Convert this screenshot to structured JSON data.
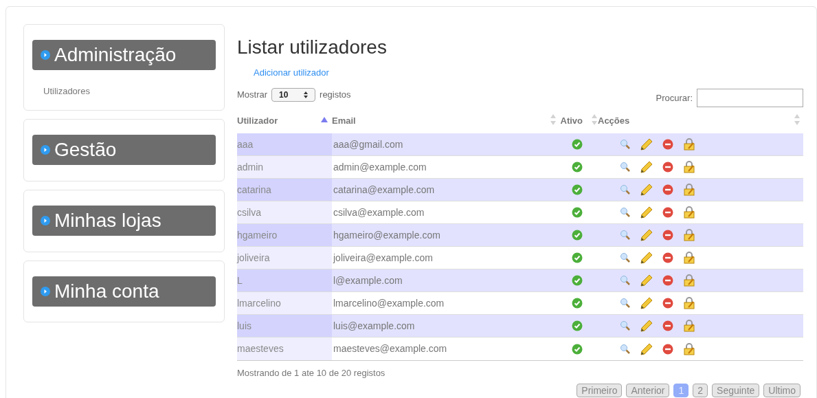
{
  "sidebar": [
    {
      "title": "Administração",
      "items": [
        "Utilizadores"
      ]
    },
    {
      "title": "Gestão"
    },
    {
      "title": "Minhas lojas"
    },
    {
      "title": "Minha conta"
    }
  ],
  "page_title": "Listar utilizadores",
  "add_link": "Adicionar utilizador",
  "length": {
    "before": "Mostrar",
    "value": "10",
    "after": "registos"
  },
  "search": {
    "label": "Procurar:"
  },
  "columns": [
    {
      "label": "Utilizador",
      "sorted": true
    },
    {
      "label": "Email",
      "sorted": false
    },
    {
      "label": "Ativo",
      "sorted": false
    },
    {
      "label": "Acções",
      "sorted": false
    }
  ],
  "rows": [
    {
      "user": "aaa",
      "email": "aaa@gmail.com",
      "active": true
    },
    {
      "user": "admin",
      "email": "admin@example.com",
      "active": true
    },
    {
      "user": "catarina",
      "email": "catarina@example.com",
      "active": true
    },
    {
      "user": "csilva",
      "email": "csilva@example.com",
      "active": true
    },
    {
      "user": "hgameiro",
      "email": "hgameiro@example.com",
      "active": true
    },
    {
      "user": "joliveira",
      "email": "joliveira@example.com",
      "active": true
    },
    {
      "user": "L",
      "email": "l@example.com",
      "active": true
    },
    {
      "user": "lmarcelino",
      "email": "lmarcelino@example.com",
      "active": true
    },
    {
      "user": "luis",
      "email": "luis@example.com",
      "active": true
    },
    {
      "user": "maesteves",
      "email": "maesteves@example.com",
      "active": true
    }
  ],
  "info": "Mostrando de 1 ate 10 de 20 registos",
  "pagination": [
    {
      "label": "Primeiro",
      "selected": false
    },
    {
      "label": "Anterior",
      "selected": false
    },
    {
      "label": "1",
      "selected": true
    },
    {
      "label": "2",
      "selected": false
    },
    {
      "label": "Seguinte",
      "selected": false
    },
    {
      "label": "Ultimo",
      "selected": false
    }
  ]
}
